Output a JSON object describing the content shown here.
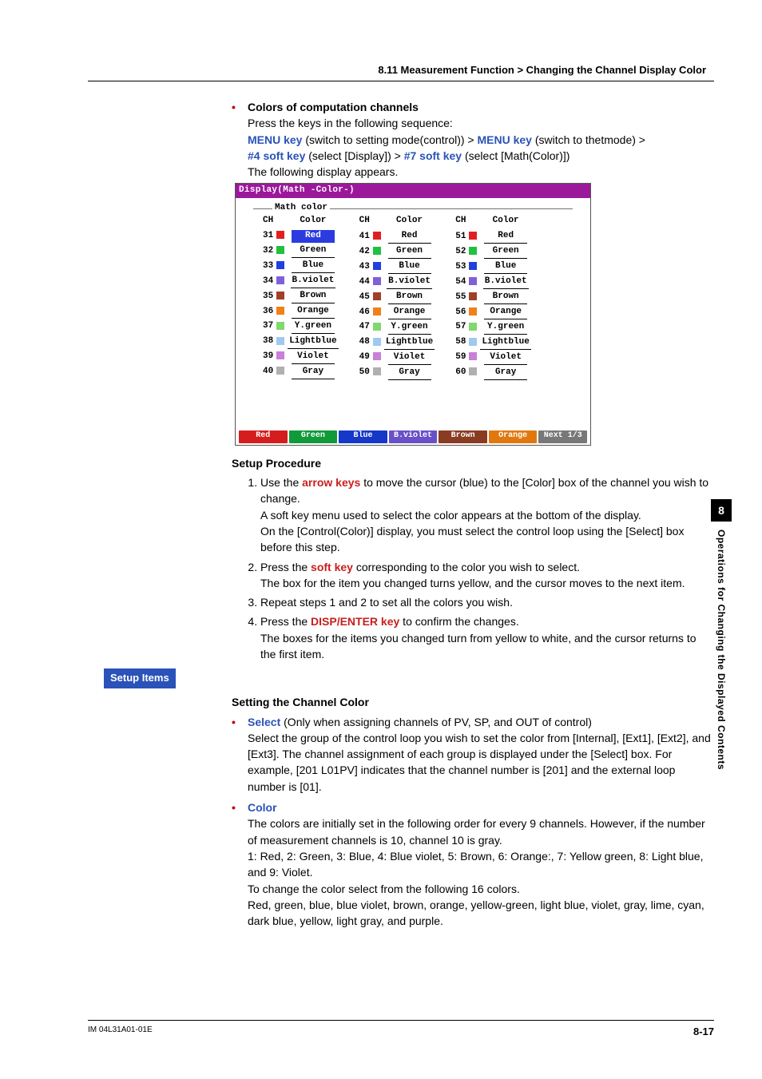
{
  "header": {
    "title": "8.11  Measurement Function > Changing the Channel Display Color"
  },
  "intro": {
    "bullet_title": "Colors of computation channels",
    "press_line": "Press the keys in the following sequence:",
    "seq_parts": {
      "menu1": "MENU key",
      "menu1_after": " (switch to setting mode(control)) > ",
      "menu2": "MENU key",
      "menu2_after": " (switch to thetmode) > ",
      "sk4": "#4 soft key",
      "sk4_after": " (select [Display]) > ",
      "sk7": "#7 soft key",
      "sk7_after": " (select [Math(Color)])"
    },
    "following_line": "The following display appears."
  },
  "screenshot": {
    "title": "Display(Math -Color-)",
    "group_label": "Math color",
    "col_headers": [
      "CH",
      "Color"
    ],
    "rows": [
      {
        "ch": "31",
        "name": "Red",
        "hex": "#e02020",
        "selected": true
      },
      {
        "ch": "32",
        "name": "Green",
        "hex": "#20c040"
      },
      {
        "ch": "33",
        "name": "Blue",
        "hex": "#2040e0"
      },
      {
        "ch": "34",
        "name": "B.violet",
        "hex": "#8060d8"
      },
      {
        "ch": "35",
        "name": "Brown",
        "hex": "#a04028"
      },
      {
        "ch": "36",
        "name": "Orange",
        "hex": "#f08018"
      },
      {
        "ch": "37",
        "name": "Y.green",
        "hex": "#80d870"
      },
      {
        "ch": "38",
        "name": "Lightblue",
        "hex": "#a0c8f0"
      },
      {
        "ch": "39",
        "name": "Violet",
        "hex": "#c880d8"
      },
      {
        "ch": "40",
        "name": "Gray",
        "hex": "#b0b0b0"
      }
    ],
    "col2_rows": [
      {
        "ch": "41",
        "name": "Red",
        "hex": "#e02020"
      },
      {
        "ch": "42",
        "name": "Green",
        "hex": "#20c040"
      },
      {
        "ch": "43",
        "name": "Blue",
        "hex": "#2040e0"
      },
      {
        "ch": "44",
        "name": "B.violet",
        "hex": "#8060d8"
      },
      {
        "ch": "45",
        "name": "Brown",
        "hex": "#a04028"
      },
      {
        "ch": "46",
        "name": "Orange",
        "hex": "#f08018"
      },
      {
        "ch": "47",
        "name": "Y.green",
        "hex": "#80d870"
      },
      {
        "ch": "48",
        "name": "Lightblue",
        "hex": "#a0c8f0"
      },
      {
        "ch": "49",
        "name": "Violet",
        "hex": "#c880d8"
      },
      {
        "ch": "50",
        "name": "Gray",
        "hex": "#b0b0b0"
      }
    ],
    "col3_rows": [
      {
        "ch": "51",
        "name": "Red",
        "hex": "#e02020"
      },
      {
        "ch": "52",
        "name": "Green",
        "hex": "#20c040"
      },
      {
        "ch": "53",
        "name": "Blue",
        "hex": "#2040e0"
      },
      {
        "ch": "54",
        "name": "B.violet",
        "hex": "#8060d8"
      },
      {
        "ch": "55",
        "name": "Brown",
        "hex": "#a04028"
      },
      {
        "ch": "56",
        "name": "Orange",
        "hex": "#f08018"
      },
      {
        "ch": "57",
        "name": "Y.green",
        "hex": "#80d870"
      },
      {
        "ch": "58",
        "name": "Lightblue",
        "hex": "#a0c8f0"
      },
      {
        "ch": "59",
        "name": "Violet",
        "hex": "#c880d8"
      },
      {
        "ch": "60",
        "name": "Gray",
        "hex": "#b0b0b0"
      }
    ],
    "softkeys": [
      {
        "label": "Red",
        "bg": "#d61d1d"
      },
      {
        "label": "Green",
        "bg": "#109a3a"
      },
      {
        "label": "Blue",
        "bg": "#1538c8"
      },
      {
        "label": "B.violet",
        "bg": "#6a50c8"
      },
      {
        "label": "Brown",
        "bg": "#8a3c22"
      },
      {
        "label": "Orange",
        "bg": "#e0780f"
      },
      {
        "label": "Next 1/3",
        "bg": "#787878"
      }
    ]
  },
  "procedure": {
    "heading": "Setup Procedure",
    "steps": [
      {
        "pre": "Use the ",
        "key": "arrow keys",
        "post": " to move the cursor (blue) to the [Color] box of the channel you wish to change.",
        "extras": [
          "A soft key menu used to select the color appears at the bottom of the display.",
          "On the [Control(Color)] display, you must select the control loop using the [Select] box before this step."
        ]
      },
      {
        "pre": "Press the ",
        "key": "soft key",
        "post": " corresponding to the color you wish to select.",
        "extras": [
          "The box for the item you changed turns yellow, and the cursor moves to the next item."
        ]
      },
      {
        "plain": "Repeat steps 1 and 2 to set all the colors you wish."
      },
      {
        "pre": "Press the ",
        "key": "DISP/ENTER key",
        "post": " to confirm the changes.",
        "extras": [
          "The boxes for the items you changed turn from yellow to white, and the cursor returns to the first item."
        ]
      }
    ]
  },
  "setup_items": {
    "tag": "Setup Items",
    "heading": "Setting the Channel Color",
    "select": {
      "title": "Select",
      "after_title": " (Only when assigning channels of PV, SP, and OUT of control)",
      "body": "Select the group of the control loop you wish to set the color from [Internal], [Ext1], [Ext2], and [Ext3].  The channel assignment of each group is displayed under the [Select] box.  For example, [201 L01PV] indicates that the channel number is [201] and the external loop number is [01]."
    },
    "color": {
      "title": "Color",
      "body1": "The colors are initially set in the following order for every 9 channels.  However, if the number of measurement channels is 10, channel 10 is gray.",
      "body2": "1: Red, 2: Green, 3: Blue, 4: Blue violet, 5: Brown, 6: Orange:, 7: Yellow green, 8: Light blue, and 9: Violet.",
      "body3": "To change the color select from the following 16 colors.",
      "body4": "Red, green, blue, blue violet, brown, orange, yellow-green, light blue, violet, gray, lime, cyan, dark blue, yellow, light gray, and purple."
    }
  },
  "sidetab": {
    "num": "8",
    "text": "Operations for Changing the Displayed Contents"
  },
  "footer": {
    "left": "IM 04L31A01-01E",
    "right": "8-17"
  }
}
